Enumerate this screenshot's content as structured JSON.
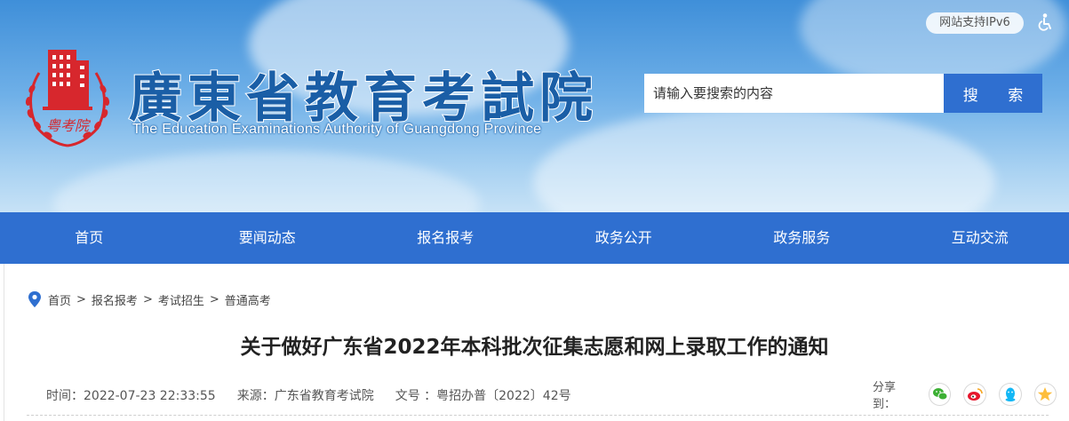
{
  "header": {
    "cn_title": "廣東省教育考試院",
    "en_title": "The Education Examinations Authority of Guangdong Province",
    "logo_text": "粤考院",
    "ipv6_label": "网站支持IPv6",
    "search_placeholder": "请输入要搜索的内容",
    "search_button": "搜 索",
    "accessibility_icon": "wheelchair-icon"
  },
  "nav": {
    "items": [
      {
        "label": "首页"
      },
      {
        "label": "要闻动态"
      },
      {
        "label": "报名报考"
      },
      {
        "label": "政务公开"
      },
      {
        "label": "政务服务"
      },
      {
        "label": "互动交流"
      }
    ]
  },
  "breadcrumb": {
    "items": [
      "首页",
      "报名报考",
      "考试招生",
      "普通高考"
    ],
    "separator": ">"
  },
  "article": {
    "title": "关于做好广东省2022年本科批次征集志愿和网上录取工作的通知",
    "time": "时间：2022-07-23 22:33:55",
    "source": "来源：广东省教育考试院",
    "doc_no": "文号 ：粤招办普〔2022〕42号"
  },
  "share": {
    "label": "分享到：",
    "icons": [
      "wechat-icon",
      "weibo-icon",
      "qq-icon",
      "qzone-icon"
    ]
  },
  "colors": {
    "nav_blue": "#2f6fd0",
    "logo_red": "#d7272d",
    "title_blue": "#1a5ea6"
  }
}
